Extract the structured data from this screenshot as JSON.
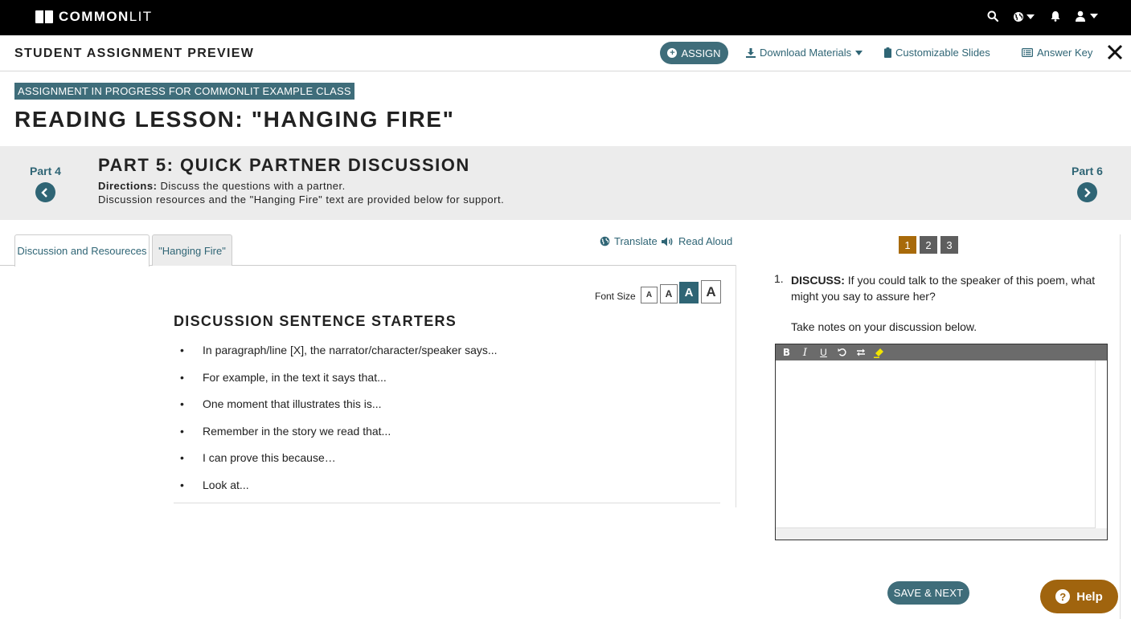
{
  "topnav": {
    "logo_bold": "COMMON",
    "logo_light": "LIT",
    "icons": [
      "search-icon",
      "globe-icon",
      "bell-icon",
      "user-icon"
    ]
  },
  "preview_bar": {
    "title": "STUDENT ASSIGNMENT PREVIEW",
    "assign_label": "ASSIGN",
    "download_label": "Download Materials",
    "slides_label": "Customizable Slides",
    "answer_key_label": "Answer Key"
  },
  "header": {
    "badge": "ASSIGNMENT IN PROGRESS FOR COMMONLIT EXAMPLE CLASS",
    "title": "READING LESSON: \"HANGING FIRE\""
  },
  "part": {
    "prev_label": "Part 4",
    "next_label": "Part 6",
    "title": "PART 5: QUICK PARTNER DISCUSSION",
    "directions_label": "Directions:",
    "directions_line1": "Discuss the questions with a partner.",
    "directions_line2": "Discussion resources and the \"Hanging Fire\" text are provided below for support."
  },
  "left_panel": {
    "tabs": [
      {
        "label": "Discussion and Resoureces",
        "active": true
      },
      {
        "label": "\"Hanging Fire\"",
        "active": false
      }
    ],
    "translate_label": "Translate",
    "read_aloud_label": "Read Aloud",
    "font_size_label": "Font Size",
    "font_sizes": [
      "A",
      "A",
      "A",
      "A"
    ],
    "font_size_active_index": 2,
    "section_title": "DISCUSSION SENTENCE STARTERS",
    "starters": [
      "In paragraph/line [X], the narrator/character/speaker says...",
      "For example, in the text it says that...",
      "One moment that illustrates this is...",
      "Remember in the story we read that...",
      "I can prove this because…",
      "Look at..."
    ]
  },
  "right_panel": {
    "question_numbers": [
      "1",
      "2",
      "3"
    ],
    "active_question": "1",
    "question_index": "1.",
    "question_label": "DISCUSS:",
    "question_text": "If you could talk to the speaker of this poem, what might you say to assure her?",
    "notes_prompt": "Take notes on your discussion below.",
    "editor_value": "",
    "save_label": "SAVE & NEXT"
  },
  "help_label": "Help",
  "colors": {
    "teal": "#3f6d7a",
    "link": "#2f6575",
    "gold": "#a86a0a",
    "band": "#ececec"
  }
}
